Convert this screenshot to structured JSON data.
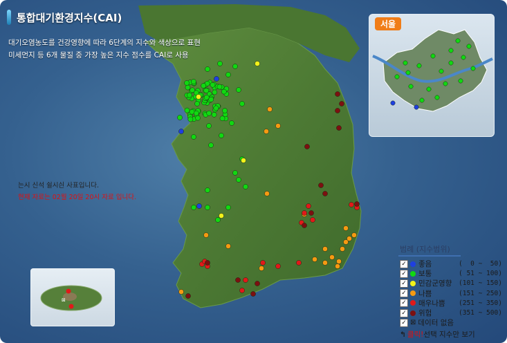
{
  "header": {
    "title": "통합대기환경지수(CAI)",
    "desc_line1": "대기오염농도를 건강영향에 따라 6단계의 지수와 색상으로 표현",
    "desc_line2": "미세먼지 등 6개 물질 중 가장 높은 지수 점수를 CAI로 사용"
  },
  "notes": {
    "partial": "는시 신석 쉴시싄 사표입니다.",
    "current": "현재 자료는 02월 20일 20시 자료 입니다."
  },
  "seoul_inset": {
    "label": "서울"
  },
  "legend": {
    "title": "범례 (지수범위)",
    "items": [
      {
        "name": "좋음",
        "range": "(  0 ~  50)",
        "color": "#1f3fe0"
      },
      {
        "name": "보통",
        "range": "( 51 ~ 100)",
        "color": "#11d811"
      },
      {
        "name": "민감군영향",
        "range": "(101 ~ 150)",
        "color": "#f2f21a"
      },
      {
        "name": "나쁨",
        "range": "(151 ~ 250)",
        "color": "#f59a12"
      },
      {
        "name": "매우나쁨",
        "range": "(251 ~ 350)",
        "color": "#e11919"
      },
      {
        "name": "위험",
        "range": "(351 ~ 500)",
        "color": "#7c1010"
      }
    ],
    "nodata": "데이터 없음",
    "click_word": "클릭!",
    "click_rest": " 선택 지수만 보기",
    "check_mark": "✓"
  },
  "colors": {
    "land": "#4f7d37",
    "land_dark": "#3a6228",
    "sea": "#2e5a8a",
    "note_current": "#e01010",
    "note_partial": "#222222"
  }
}
